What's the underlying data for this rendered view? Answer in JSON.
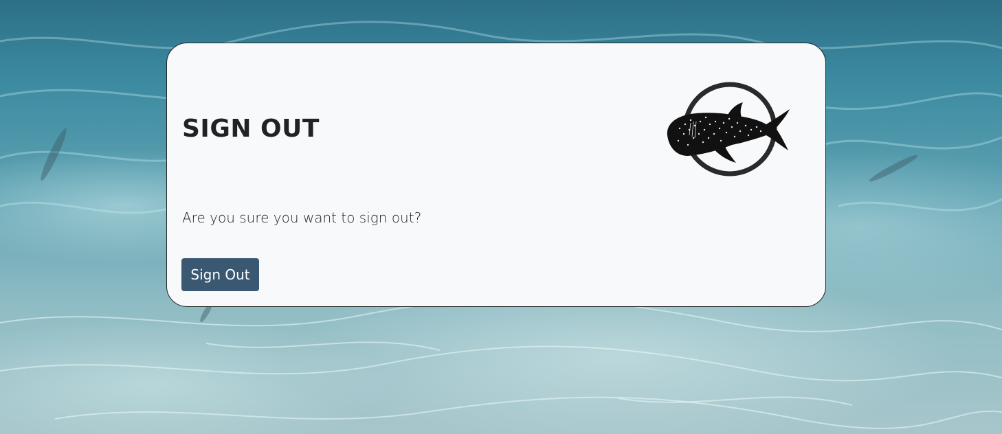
{
  "page": {
    "title": "SIGN OUT",
    "prompt": "Are you sure you want to sign out?",
    "sign_out_label": "Sign Out"
  },
  "logo": {
    "icon": "whale-shark-logo"
  },
  "colors": {
    "card_background": "#f7f9fb",
    "button_background": "#3b5872",
    "button_text": "#ffffff",
    "title_text": "#222222"
  }
}
